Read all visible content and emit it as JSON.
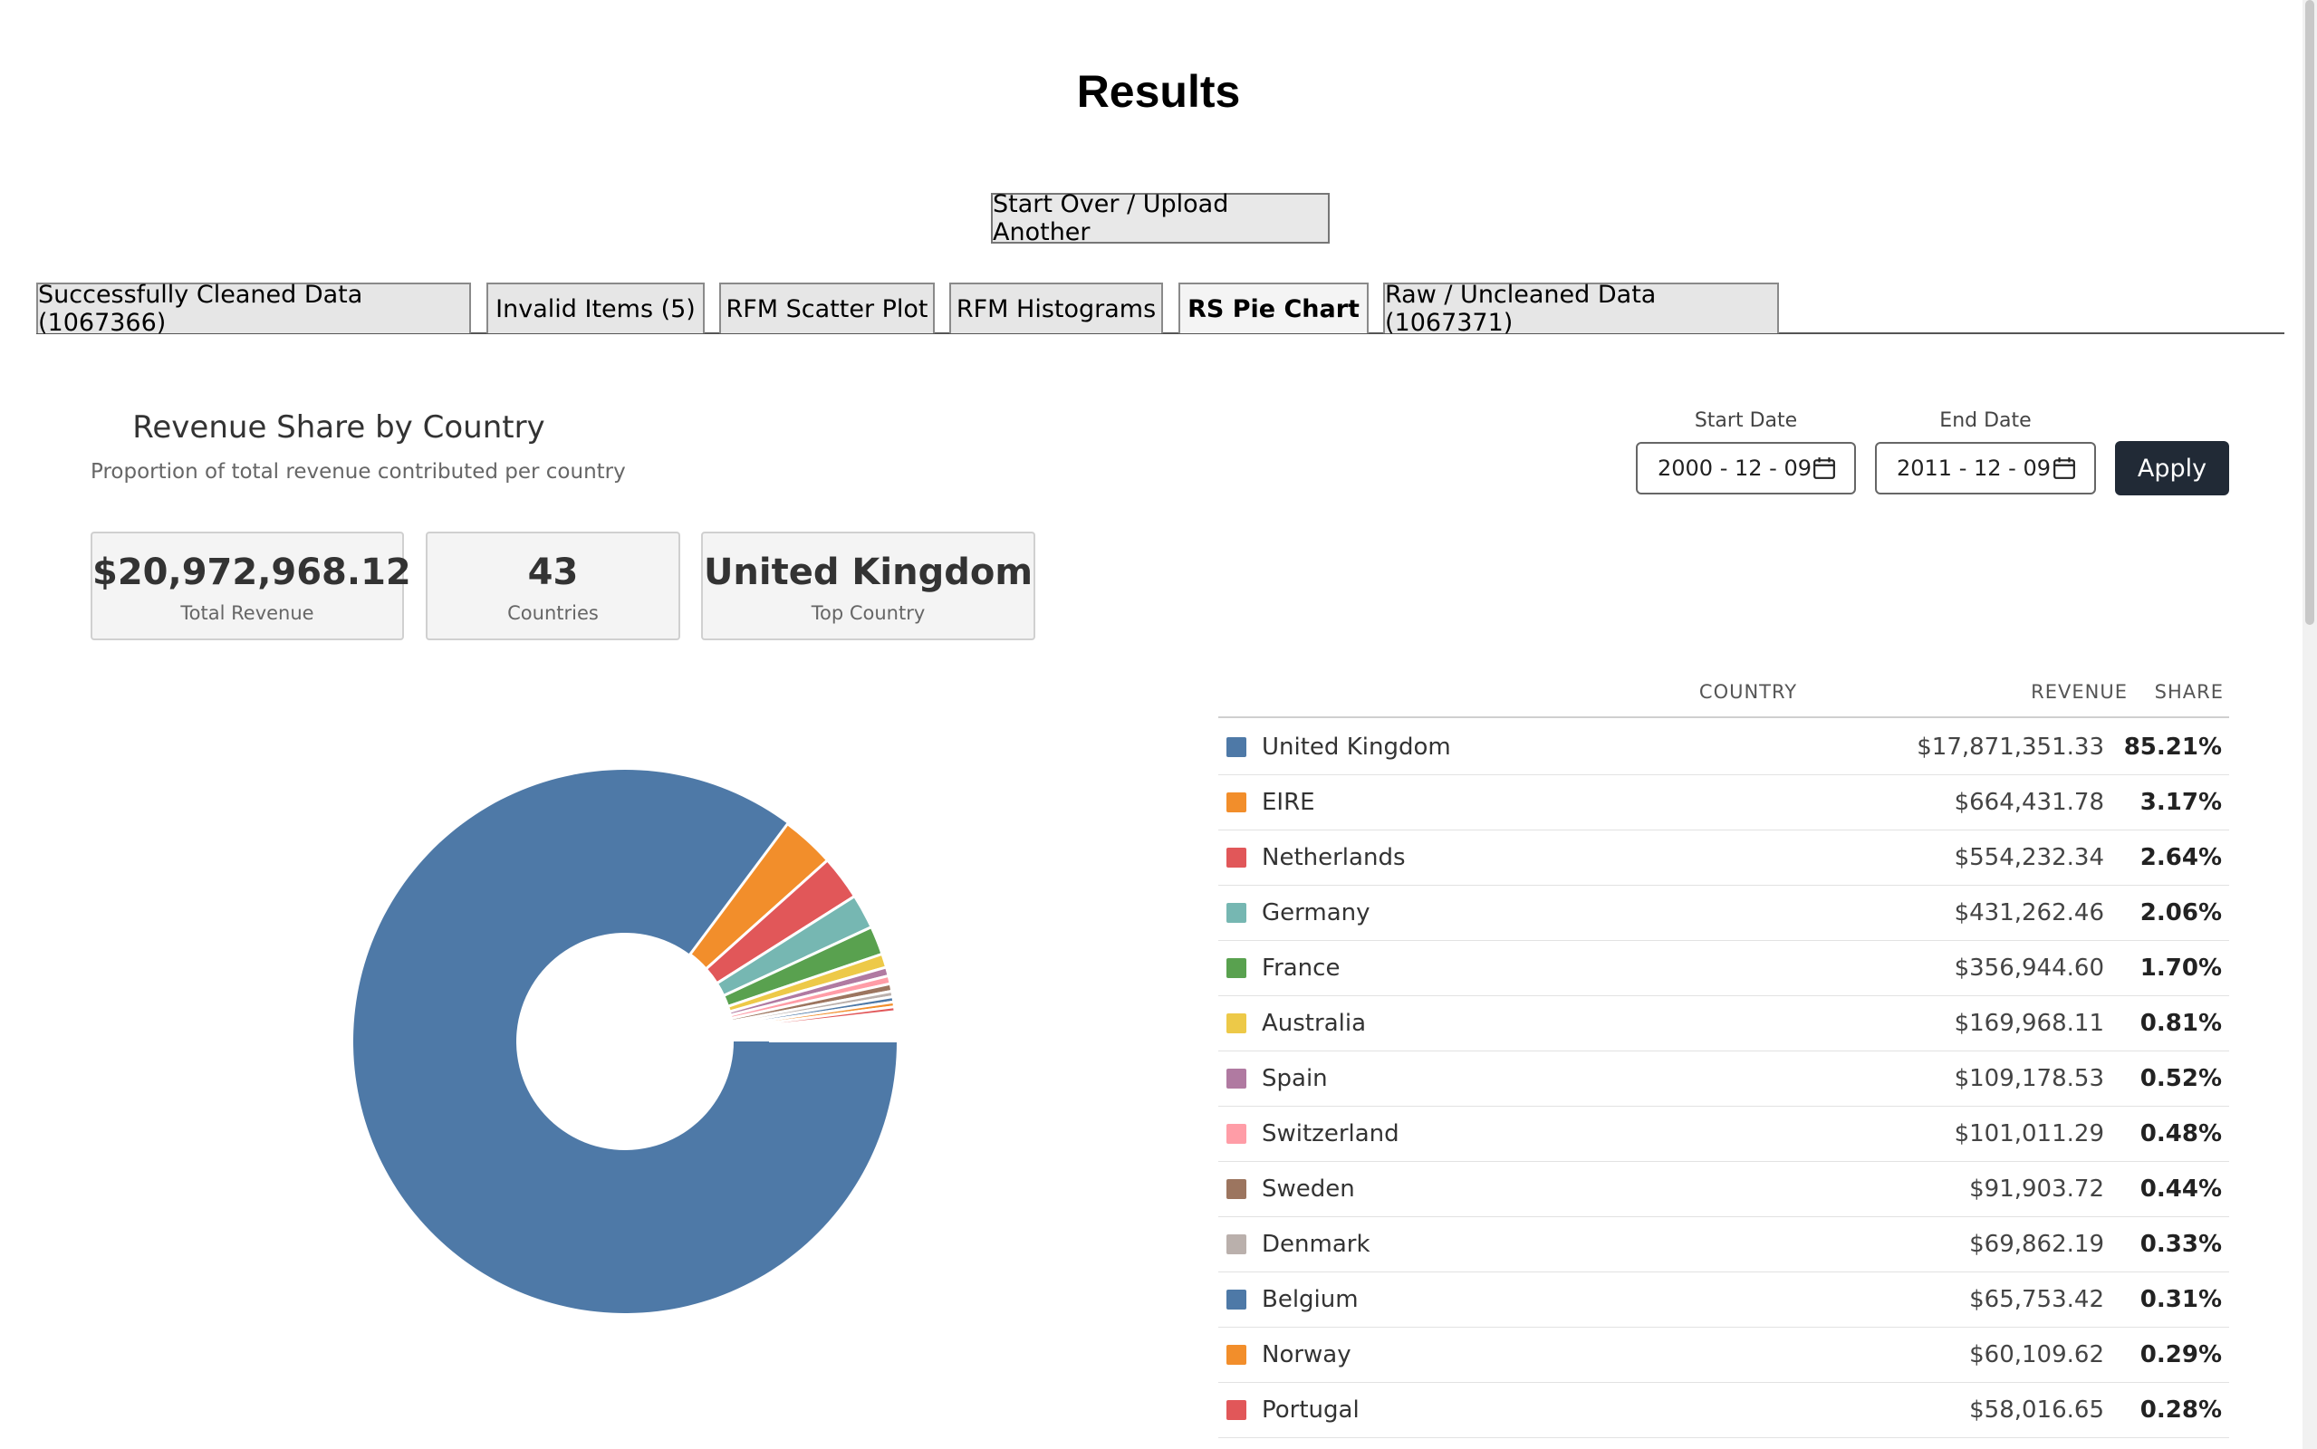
{
  "page": {
    "title": "Results"
  },
  "actions": {
    "start_over_label": "Start Over / Upload Another"
  },
  "tabs": [
    {
      "label": "Successfully Cleaned Data (1067366)",
      "active": false
    },
    {
      "label": "Invalid Items (5)",
      "active": false
    },
    {
      "label": "RFM Scatter Plot",
      "active": false
    },
    {
      "label": "RFM Histograms",
      "active": false
    },
    {
      "label": "RS Pie Chart",
      "active": true
    },
    {
      "label": "Raw / Uncleaned Data (1067371)",
      "active": false
    }
  ],
  "panel": {
    "title": "Revenue Share by Country",
    "subtitle": "Proportion of total revenue contributed per country"
  },
  "stats": [
    {
      "value": "$20,972,968.12",
      "label": "Total Revenue"
    },
    {
      "value": "43",
      "label": "Countries"
    },
    {
      "value": "United Kingdom",
      "label": "Top Country"
    }
  ],
  "date_filter": {
    "start_label": "Start Date",
    "start_value": "2000 - 12 - 09",
    "end_label": "End Date",
    "end_value": "2011 - 12 - 09",
    "apply_label": "Apply"
  },
  "table": {
    "headers": {
      "country": "COUNTRY",
      "revenue": "REVENUE",
      "share": "SHARE"
    },
    "rows": [
      {
        "country": "United Kingdom",
        "revenue": "$17,871,351.33",
        "share": "85.21%",
        "color": "#4e79a7"
      },
      {
        "country": "EIRE",
        "revenue": "$664,431.78",
        "share": "3.17%",
        "color": "#f28e2b"
      },
      {
        "country": "Netherlands",
        "revenue": "$554,232.34",
        "share": "2.64%",
        "color": "#e15759"
      },
      {
        "country": "Germany",
        "revenue": "$431,262.46",
        "share": "2.06%",
        "color": "#76b7b2"
      },
      {
        "country": "France",
        "revenue": "$356,944.60",
        "share": "1.70%",
        "color": "#59a14f"
      },
      {
        "country": "Australia",
        "revenue": "$169,968.11",
        "share": "0.81%",
        "color": "#edc948"
      },
      {
        "country": "Spain",
        "revenue": "$109,178.53",
        "share": "0.52%",
        "color": "#b07aa1"
      },
      {
        "country": "Switzerland",
        "revenue": "$101,011.29",
        "share": "0.48%",
        "color": "#ff9da7"
      },
      {
        "country": "Sweden",
        "revenue": "$91,903.72",
        "share": "0.44%",
        "color": "#9c755f"
      },
      {
        "country": "Denmark",
        "revenue": "$69,862.19",
        "share": "0.33%",
        "color": "#bab0ac"
      },
      {
        "country": "Belgium",
        "revenue": "$65,753.42",
        "share": "0.31%",
        "color": "#4e79a7"
      },
      {
        "country": "Norway",
        "revenue": "$60,109.62",
        "share": "0.29%",
        "color": "#f28e2b"
      },
      {
        "country": "Portugal",
        "revenue": "$58,016.65",
        "share": "0.28%",
        "color": "#e15759"
      }
    ]
  },
  "chart_data": {
    "type": "pie",
    "style": "donut",
    "categories": [
      "United Kingdom",
      "EIRE",
      "Netherlands",
      "Germany",
      "France",
      "Australia",
      "Spain",
      "Switzerland",
      "Sweden",
      "Denmark",
      "Belgium",
      "Norway",
      "Portugal"
    ],
    "values": [
      85.21,
      3.17,
      2.64,
      2.06,
      1.7,
      0.81,
      0.52,
      0.48,
      0.44,
      0.33,
      0.31,
      0.29,
      0.28
    ],
    "palette": [
      "#4e79a7",
      "#f28e2b",
      "#e15759",
      "#76b7b2",
      "#59a14f",
      "#edc948",
      "#b07aa1",
      "#ff9da7",
      "#9c755f",
      "#bab0ac"
    ]
  }
}
